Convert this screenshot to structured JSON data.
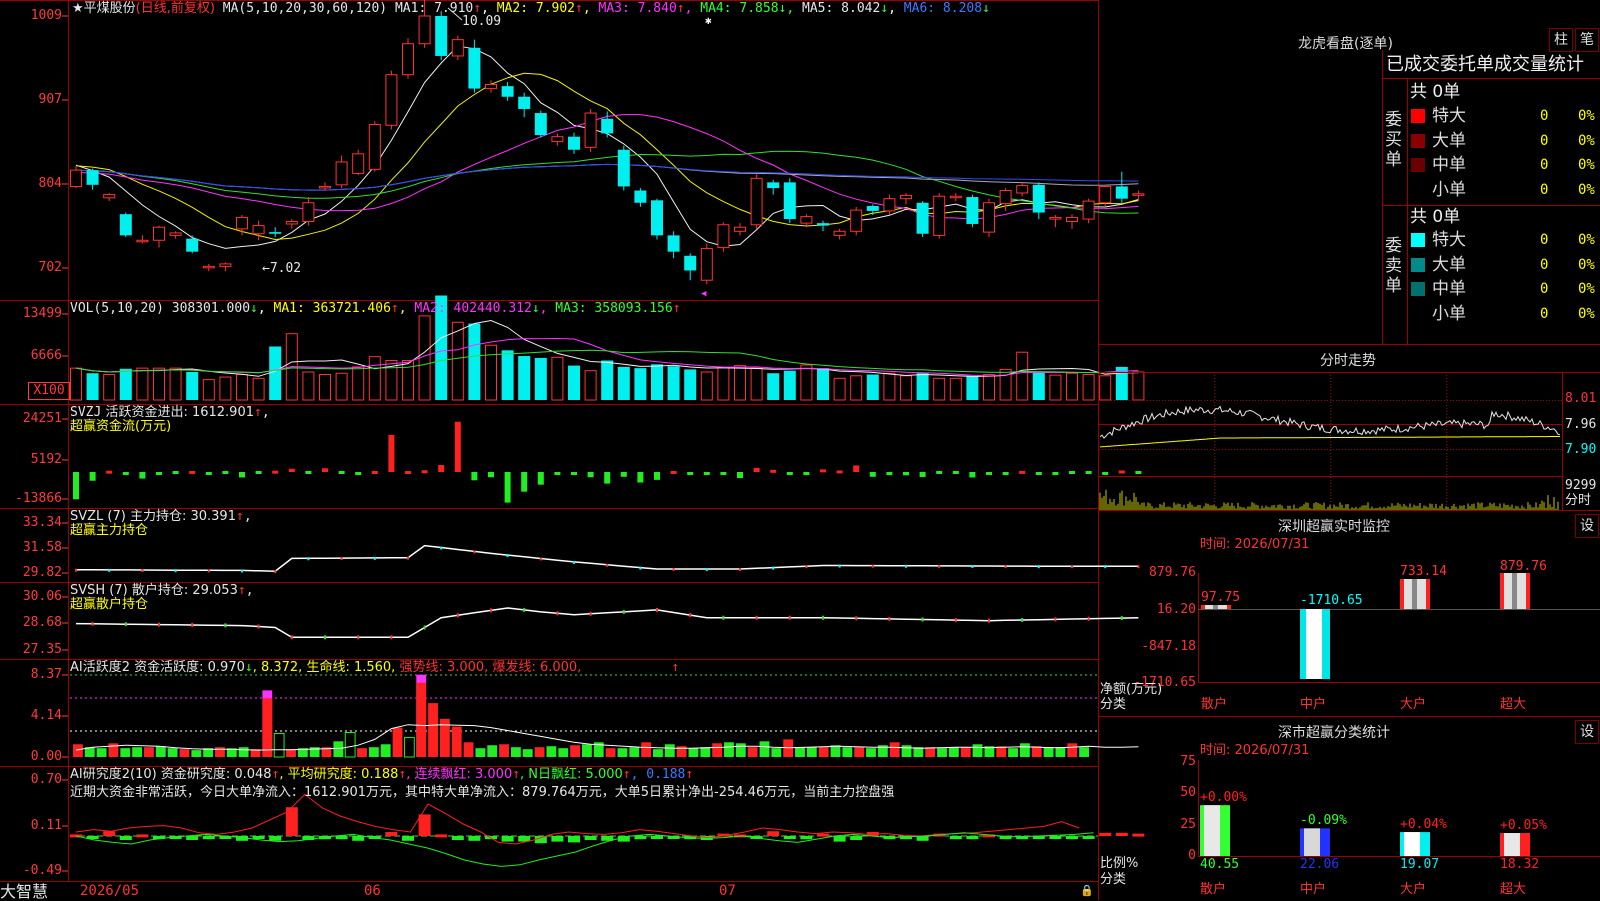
{
  "colors": {
    "up": "#ff3333",
    "down": "#00f0f0",
    "grid": "#9a0000",
    "ma1": "#f0f0f0",
    "ma2": "#f2f200",
    "ma3": "#ff33ff",
    "ma4": "#33dd33",
    "ma5": "#aaaaaa",
    "ma6": "#2d4dff",
    "vol_ma1": "#f0f0f0",
    "vol_ma2": "#ff33ff",
    "vol_ma3": "#33dd33"
  },
  "main": {
    "name": "★平煤股份",
    "mode": "(日线,前复权)",
    "ma_label": "MA(5,10,20,30,60,120)",
    "ma1": "MA1: 7.910",
    "ma1_arrow": "↑",
    "ma2": "MA2: 7.902",
    "ma2_arrow": "↑",
    "ma3": "MA3: 7.840",
    "ma3_arrow": "↑",
    "ma4": "MA4: 7.858",
    "ma4_arrow": "↓",
    "ma5": "MA5: 8.042",
    "ma5_arrow": "↓",
    "ma6": "MA6: 8.208",
    "ma6_arrow": "↓",
    "high_mark": "10.09",
    "low_mark": "←7.02",
    "y_ticks": [
      "1009",
      "907",
      "804",
      "702"
    ]
  },
  "candles": {
    "o": [
      8.0,
      8.2,
      7.86,
      7.66,
      7.34,
      7.34,
      7.4,
      7.36,
      7.02,
      7.02,
      7.48,
      7.42,
      7.44,
      7.54,
      7.57,
      8.0,
      8.02,
      8.16,
      8.21,
      8.75,
      9.37,
      9.75,
      10.09,
      9.6,
      9.7,
      9.2,
      9.23,
      9.1,
      8.9,
      8.55,
      8.61,
      8.48,
      8.83,
      8.45,
      7.95,
      7.83,
      7.4,
      7.15,
      6.85,
      7.25,
      7.45,
      7.53,
      8.05,
      8.05,
      7.55,
      7.55,
      7.4,
      7.45,
      7.76,
      7.7,
      7.85,
      7.8,
      7.4,
      7.87,
      7.87,
      7.44,
      7.79,
      7.92,
      8.02,
      7.6,
      7.57,
      7.6,
      7.8,
      8.0,
      7.9
    ],
    "c": [
      8.2,
      8.02,
      7.9,
      7.4,
      7.34,
      7.5,
      7.43,
      7.2,
      7.02,
      7.05,
      7.62,
      7.52,
      7.42,
      7.57,
      7.8,
      8.0,
      8.3,
      8.4,
      8.76,
      9.37,
      9.75,
      10.09,
      9.6,
      9.8,
      9.2,
      9.25,
      9.1,
      8.95,
      8.63,
      8.61,
      8.45,
      8.9,
      8.65,
      8.0,
      7.8,
      7.4,
      7.2,
      6.97,
      7.24,
      7.53,
      7.5,
      8.1,
      7.98,
      7.6,
      7.63,
      7.52,
      7.45,
      7.71,
      7.7,
      7.85,
      7.89,
      7.42,
      7.88,
      7.88,
      7.54,
      7.8,
      7.95,
      8.01,
      7.68,
      7.62,
      7.62,
      7.82,
      8.0,
      7.85,
      7.91
    ],
    "h": [
      8.25,
      8.22,
      7.92,
      7.68,
      7.4,
      7.52,
      7.45,
      7.4,
      7.05,
      7.07,
      7.65,
      7.58,
      7.5,
      7.6,
      7.87,
      8.05,
      8.38,
      8.45,
      8.8,
      9.42,
      9.82,
      10.45,
      10.15,
      9.85,
      9.8,
      9.3,
      9.28,
      9.15,
      8.93,
      8.65,
      8.66,
      8.95,
      8.92,
      8.5,
      7.98,
      7.85,
      7.45,
      7.18,
      7.3,
      7.56,
      7.55,
      8.15,
      8.08,
      8.1,
      7.66,
      7.58,
      7.48,
      7.75,
      7.78,
      7.9,
      7.92,
      7.82,
      7.92,
      7.92,
      7.9,
      7.85,
      7.98,
      8.05,
      8.05,
      7.65,
      7.66,
      7.85,
      8.02,
      8.18,
      7.95
    ],
    "l": [
      7.98,
      7.96,
      7.82,
      7.38,
      7.3,
      7.25,
      7.36,
      7.18,
      6.96,
      6.96,
      7.4,
      7.34,
      7.38,
      7.48,
      7.52,
      7.95,
      7.98,
      8.14,
      8.18,
      8.7,
      9.32,
      9.7,
      9.55,
      9.55,
      9.15,
      9.15,
      9.05,
      8.85,
      8.6,
      8.5,
      8.4,
      8.42,
      8.6,
      7.95,
      7.75,
      7.35,
      7.12,
      6.85,
      6.8,
      7.2,
      7.4,
      7.48,
      7.9,
      7.55,
      7.5,
      7.45,
      7.35,
      7.4,
      7.65,
      7.65,
      7.78,
      7.38,
      7.36,
      7.82,
      7.5,
      7.38,
      7.7,
      7.88,
      7.6,
      7.5,
      7.48,
      7.55,
      7.76,
      7.8,
      7.82
    ]
  },
  "volume": {
    "label": "VOL(5,10,20)",
    "value": "308301.000",
    "value_arrow": "↓",
    "ma1": "MA1: 363721.406",
    "ma1_arrow": "↑",
    "ma2": "MA2: 402440.312",
    "ma2_arrow": "↓",
    "ma3": "MA3: 358093.156",
    "ma3_arrow": "↑",
    "y_ticks": [
      "13499",
      "6666"
    ],
    "unit": "X100",
    "values": [
      5000,
      4200,
      4000,
      4900,
      5000,
      5000,
      5000,
      4400,
      3200,
      3600,
      4000,
      3400,
      8400,
      10400,
      4400,
      4000,
      4200,
      5200,
      6800,
      6200,
      6200,
      13200,
      16400,
      12200,
      12000,
      8600,
      7800,
      6900,
      6600,
      6700,
      5400,
      4600,
      6200,
      5200,
      5000,
      5600,
      5300,
      4800,
      4400,
      5100,
      5400,
      5000,
      4200,
      4600,
      5500,
      5000,
      3400,
      3800,
      4000,
      4200,
      3800,
      4200,
      3400,
      3400,
      3700,
      4000,
      4800,
      7500,
      4300,
      3900,
      4200,
      4000,
      3800,
      5200,
      4400
    ]
  },
  "svzj": {
    "label": "SVZJ",
    "text": " 活跃资金进出: 1612.901",
    "arrow": "↑",
    "tail": ",",
    "sub": "超赢资金流(万元)",
    "y_ticks": [
      "24251",
      "5192",
      "-13866"
    ],
    "values": [
      -12500,
      -4000,
      600,
      -900,
      -3000,
      -800,
      -200,
      0,
      -900,
      -300,
      -2500,
      -200,
      600,
      1500,
      -300,
      1700,
      -200,
      -1300,
      100,
      17000,
      300,
      800,
      3200,
      23000,
      -3800,
      -2400,
      -14000,
      -9000,
      -5800,
      -600,
      -400,
      -2400,
      -5300,
      -2200,
      -4800,
      -3600,
      200,
      -800,
      -1200,
      -400,
      -2800,
      1900,
      1000,
      -600,
      -800,
      1200,
      700,
      3000,
      -2200,
      -1400,
      -1500,
      -2300,
      -300,
      -300,
      -2500,
      -800,
      -600,
      500,
      -1000,
      -700,
      -100,
      -100,
      -1000,
      700,
      -300
    ]
  },
  "svzl": {
    "label": "SVZL (7) 主力持仓: 30.391",
    "arrow": "↑",
    "tail": ",",
    "sub": "超赢主力持仓",
    "y_ticks": [
      "33.34",
      "31.58",
      "29.82"
    ]
  },
  "svsh": {
    "label": "SVSH (7) 散户持仓: 29.053",
    "arrow": "↑",
    "tail": ",",
    "sub": "超赢散户持仓",
    "y_ticks": [
      "30.06",
      "28.68",
      "27.35"
    ]
  },
  "ai_active": {
    "label": "AI活跃度2",
    "a": " 资金活跃度: 0.970",
    "a_arrow": "↓",
    "b": ", 8.372, 生命线: 1.560,",
    "c": " 强势线: 3.000, 爆发线: 6.000,",
    "d": "↑",
    "y_ticks": [
      "8.37",
      "4.14",
      "0.00"
    ],
    "values": [
      1.3,
      1.0,
      0.9,
      1.4,
      0.9,
      1.0,
      1.0,
      1.1,
      0.9,
      0.8,
      0.7,
      0.9,
      1.0,
      0.9,
      1.0,
      0.8,
      6.8,
      2.4,
      0.8,
      0.9,
      1.0,
      1.0,
      1.6,
      2.5,
      0.9,
      1.0,
      1.3,
      3.0,
      2.0,
      8.4,
      5.5,
      3.9,
      3.1,
      1.5,
      0.9,
      1.2,
      1.3,
      1.0,
      0.8,
      1.0,
      1.1,
      0.9,
      1.2,
      1.3,
      1.5,
      0.9,
      0.9,
      1.0,
      1.5,
      0.8,
      1.3,
      1.1,
      0.9,
      1.0,
      1.4,
      1.5,
      1.4,
      1.0,
      1.6,
      0.9,
      1.8,
      1.0,
      1.0,
      1.0,
      1.2,
      1.0,
      1.0,
      0.9,
      1.2,
      1.5,
      1.2,
      1.0,
      1.0,
      0.9,
      1.0,
      1.0,
      1.3,
      1.1,
      1.1,
      0.9,
      1.4,
      1.1,
      1.0,
      1.0,
      1.4,
      1.0
    ],
    "line": [
      0.7,
      1.0,
      1.1,
      1.2,
      1.15,
      1.1,
      0.95,
      0.85,
      0.8,
      0.8,
      0.75,
      0.7,
      0.75,
      0.75,
      0.8,
      0.85,
      0.9,
      1.2,
      1.8,
      2.9,
      3.3,
      3.2,
      3.3,
      3.25,
      3.2,
      3.0,
      2.7,
      2.4,
      2.1,
      1.8,
      1.5,
      1.3,
      1.2,
      1.1,
      1.0,
      0.95,
      0.9,
      0.9,
      0.95,
      1.0,
      1.1,
      1.1,
      1.0,
      0.95,
      1.0,
      1.05,
      1.1,
      1.05,
      1.0,
      1.0,
      0.95,
      0.9,
      0.95,
      1.0,
      1.0,
      0.95,
      1.0,
      1.05,
      1.0,
      0.95,
      1.0,
      1.1,
      1.0,
      1.0,
      1.05
    ]
  },
  "ai_research": {
    "label": "AI研究度2(10)",
    "a": " 资金研究度: 0.048",
    "a_arrow": "↑",
    "b": ", 平均研究度: 0.188",
    "b_arrow": "↑",
    "c": ", 连续飘红: 3.000",
    "c_arrow": "↑",
    "d": ", N日飘红: 5.000",
    "d_arrow": "↑",
    "e": ", 0.188",
    "e_arrow": "↑",
    "summary": "近期大资金非常活跃，今日大单净流入：1612.901万元，其中特大单净流入：879.764万元，大单5日累计净出-254.46万元，当前主力控盘强",
    "y_ticks": [
      "0.70",
      "0.11",
      "-0.49"
    ],
    "values": [
      0.02,
      -0.01,
      0.06,
      -0.05,
      0.02,
      -0.02,
      -0.01,
      -0.05,
      -0.04,
      -0.01,
      -0.06,
      -0.02,
      -0.06,
      0.36,
      -0.05,
      -0.04,
      -0.04,
      -0.06,
      -0.03,
      0.05,
      -0.06,
      0.27,
      0.02,
      -0.05,
      -0.06,
      -0.04,
      -0.07,
      -0.07,
      -0.09,
      -0.07,
      -0.08,
      -0.05,
      -0.06,
      -0.07,
      -0.04,
      -0.03,
      -0.01,
      -0.04,
      -0.05,
      0.03,
      0.02,
      -0.03,
      0.06,
      -0.03,
      -0.04,
      0.03,
      -0.07,
      -0.05,
      0.05,
      -0.04,
      -0.04,
      -0.06,
      0.03,
      -0.04,
      -0.04,
      0.02,
      -0.04,
      -0.04,
      -0.03,
      -0.02,
      -0.04,
      -0.03,
      0.04,
      0.04,
      0.03
    ],
    "red": [
      0.05,
      0.08,
      0.06,
      0.1,
      0.12,
      0.13,
      0.1,
      0.04,
      0.02,
      0.05,
      0.1,
      0.2,
      0.3,
      0.52,
      0.35,
      0.25,
      0.18,
      0.12,
      0.08,
      0.05,
      0.4,
      0.28,
      0.15,
      0.05,
      -0.08,
      -0.1,
      -0.05,
      0.02,
      0.05,
      0.03,
      0.02,
      0.04,
      0.08,
      0.06,
      0.03,
      0.0,
      -0.02,
      0.01,
      0.05,
      0.1,
      0.08,
      0.05,
      0.03,
      0.05,
      0.04,
      0.02,
      0.03,
      0.01,
      0.0,
      0.02,
      0.03,
      0.04,
      0.06,
      0.08,
      0.1,
      0.12,
      0.18,
      0.1
    ],
    "green": [
      0.0,
      -0.05,
      -0.08,
      -0.1,
      -0.05,
      -0.02,
      0.0,
      0.02,
      0.0,
      -0.02,
      -0.05,
      -0.07,
      -0.06,
      -0.03,
      0.0,
      0.02,
      -0.02,
      -0.05,
      -0.1,
      -0.15,
      -0.22,
      -0.3,
      -0.35,
      -0.38,
      -0.36,
      -0.3,
      -0.25,
      -0.2,
      -0.12,
      -0.05,
      0.0,
      0.02,
      0.0,
      -0.02,
      -0.03,
      -0.02,
      0.0,
      -0.03,
      -0.06,
      -0.08,
      -0.04,
      0.0,
      0.02,
      0.0,
      -0.02,
      -0.01,
      0.0,
      0.02,
      0.04,
      0.02,
      0.0,
      -0.01,
      0.0,
      0.01,
      0.02,
      0.04
    ]
  },
  "date_axis": {
    "first": "2026/05",
    "second": "06",
    "third": "07",
    "corner": "大智慧"
  },
  "right": {
    "lhb_title": "龙虎看盘(逐单)",
    "btn1": "柱",
    "btn2": "笔",
    "order_title": "已成交委托单成交量统计",
    "buy_label": "委买单",
    "sell_label": "委卖单",
    "buy_total": "共 0单",
    "sell_total": "共 0单",
    "buy_rows": [
      {
        "name": "特大",
        "n": "0",
        "p": "0%",
        "color": "#ff0000"
      },
      {
        "name": "大单",
        "n": "0",
        "p": "0%",
        "color": "#8a0000"
      },
      {
        "name": "中单",
        "n": "0",
        "p": "0%",
        "color": "#6a0000"
      },
      {
        "name": "小单",
        "n": "0",
        "p": "0%",
        "color": ""
      }
    ],
    "sell_rows": [
      {
        "name": "特大",
        "n": "0",
        "p": "0%",
        "color": "#00ffff"
      },
      {
        "name": "大单",
        "n": "0",
        "p": "0%",
        "color": "#008a8a"
      },
      {
        "name": "中单",
        "n": "0",
        "p": "0%",
        "color": "#007070"
      },
      {
        "name": "小单",
        "n": "0",
        "p": "0%",
        "color": ""
      }
    ],
    "fs_title": "分时走势",
    "fs_ticks": [
      "8.01",
      "7.96",
      "7.90"
    ],
    "fs_vol": "9299",
    "fs_vol_unit": "分时",
    "rt_title": "深圳超赢实时监控",
    "rt_time": "时间: 2026/07/31",
    "set": "设",
    "rt_ticks": [
      "879.76",
      "16.20",
      "-847.18",
      "-1710.65"
    ],
    "rt_bars": [
      {
        "label": "散户",
        "value": "97.75",
        "v": 97.75
      },
      {
        "label": "中户",
        "value": "-1710.65",
        "v": -1710.65
      },
      {
        "label": "大户",
        "value": "733.14",
        "v": 733.14
      },
      {
        "label": "超大",
        "value": "879.76",
        "v": 879.76
      }
    ],
    "rt_ylabel": "净额(万元)",
    "rt_xlabel": "分类",
    "cls_title": "深市超赢分类统计",
    "cls_time": "时间: 2026/07/31",
    "cls_ticks": [
      "75",
      "50",
      "25",
      "0"
    ],
    "cls_bars": [
      {
        "label": "散户",
        "value": "40.55",
        "pct": "+0.00%",
        "v": 40.55
      },
      {
        "label": "中户",
        "value": "22.06",
        "pct": "-0.09%",
        "v": 22.06
      },
      {
        "label": "大户",
        "value": "19.07",
        "pct": "+0.04%",
        "v": 19.07
      },
      {
        "label": "超大",
        "value": "18.32",
        "pct": "+0.05%",
        "v": 18.32
      }
    ],
    "cls_ylabel": "比例%",
    "cls_xlabel": "分类"
  }
}
